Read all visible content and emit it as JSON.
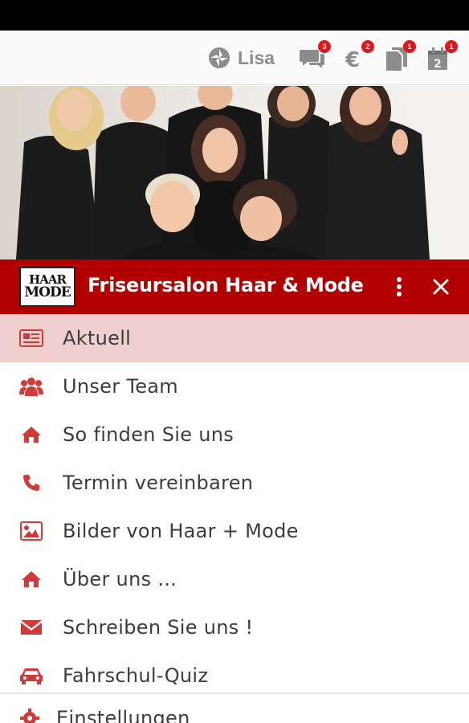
{
  "top_bar": {
    "user_name": "Lisa",
    "badges": {
      "messages": "3",
      "payments": "2",
      "documents": "1",
      "calendar": "1"
    }
  },
  "header": {
    "title": "Friseursalon Haar & Mode",
    "logo_line1": "HAAR",
    "logo_line2": "MODE"
  },
  "menu": {
    "items": [
      {
        "label": "Aktuell",
        "icon": "newspaper-icon"
      },
      {
        "label": "Unser Team",
        "icon": "users-icon"
      },
      {
        "label": "So finden Sie uns",
        "icon": "home-icon"
      },
      {
        "label": "Termin vereinbaren",
        "icon": "phone-icon"
      },
      {
        "label": "Bilder von Haar + Mode",
        "icon": "image-icon"
      },
      {
        "label": "Über uns ...",
        "icon": "home-icon"
      },
      {
        "label": "Schreiben Sie uns !",
        "icon": "envelope-icon"
      },
      {
        "label": "Fahrschul-Quiz",
        "icon": "car-icon"
      }
    ],
    "settings_label": "Einstellungen"
  },
  "colors": {
    "brand_red": "#b20000",
    "icon_red": "#d23a3a",
    "active_bg": "#f0cfcf",
    "badge_red": "#e1161b"
  }
}
